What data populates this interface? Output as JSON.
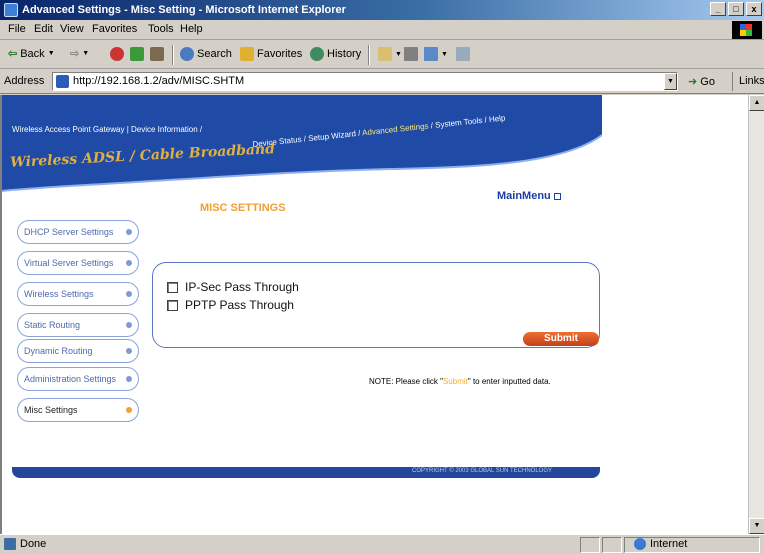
{
  "window": {
    "title": "Advanced Settings - Misc Setting - Microsoft Internet Explorer",
    "controls": [
      "_",
      "□",
      "x"
    ]
  },
  "menu": [
    "File",
    "Edit",
    "View",
    "Favorites",
    "Tools",
    "Help"
  ],
  "toolbar": {
    "back": "Back",
    "search": "Search",
    "favorites": "Favorites",
    "history": "History"
  },
  "address": {
    "label": "Address",
    "url": "http://192.168.1.2/adv/MISC.SHTM",
    "go": "Go",
    "links": "Links"
  },
  "page": {
    "nav_left": "Wireless Access Point Gateway | Device Information /",
    "nav_wave": "Device Status / Setup Wizard /",
    "nav_adv": "Advanced Settings",
    "nav_tail": "/ System Tools / Help",
    "brand": "Wireless ADSL / Cable Broadband",
    "main_menu": "MainMenu",
    "title": "MISC SETTINGS",
    "sidebar": [
      {
        "label": "DHCP Server Settings"
      },
      {
        "label": "Virtual Server Settings"
      },
      {
        "label": "Wireless Settings"
      },
      {
        "label": "Static Routing"
      },
      {
        "label": "Dynamic Routing"
      },
      {
        "label": "Administration Settings"
      },
      {
        "label": "Misc Settings"
      }
    ],
    "options": [
      {
        "label": "IP-Sec Pass Through",
        "checked": false
      },
      {
        "label": "PPTP Pass Through",
        "checked": false
      }
    ],
    "submit": "Submit",
    "note_prefix": "NOTE: Please click \"",
    "note_highlight": "Submit",
    "note_suffix": "\" to enter inputted data.",
    "copyright": "COPYRIGHT © 2003 GLOBAL SUN TECHNOLOGY"
  },
  "status": {
    "left": "Done",
    "zone": "Internet"
  },
  "colors": {
    "banner_blue": "#1f4ba6",
    "accent_orange": "#f0a030",
    "sidebar_text": "#4d6cab"
  }
}
